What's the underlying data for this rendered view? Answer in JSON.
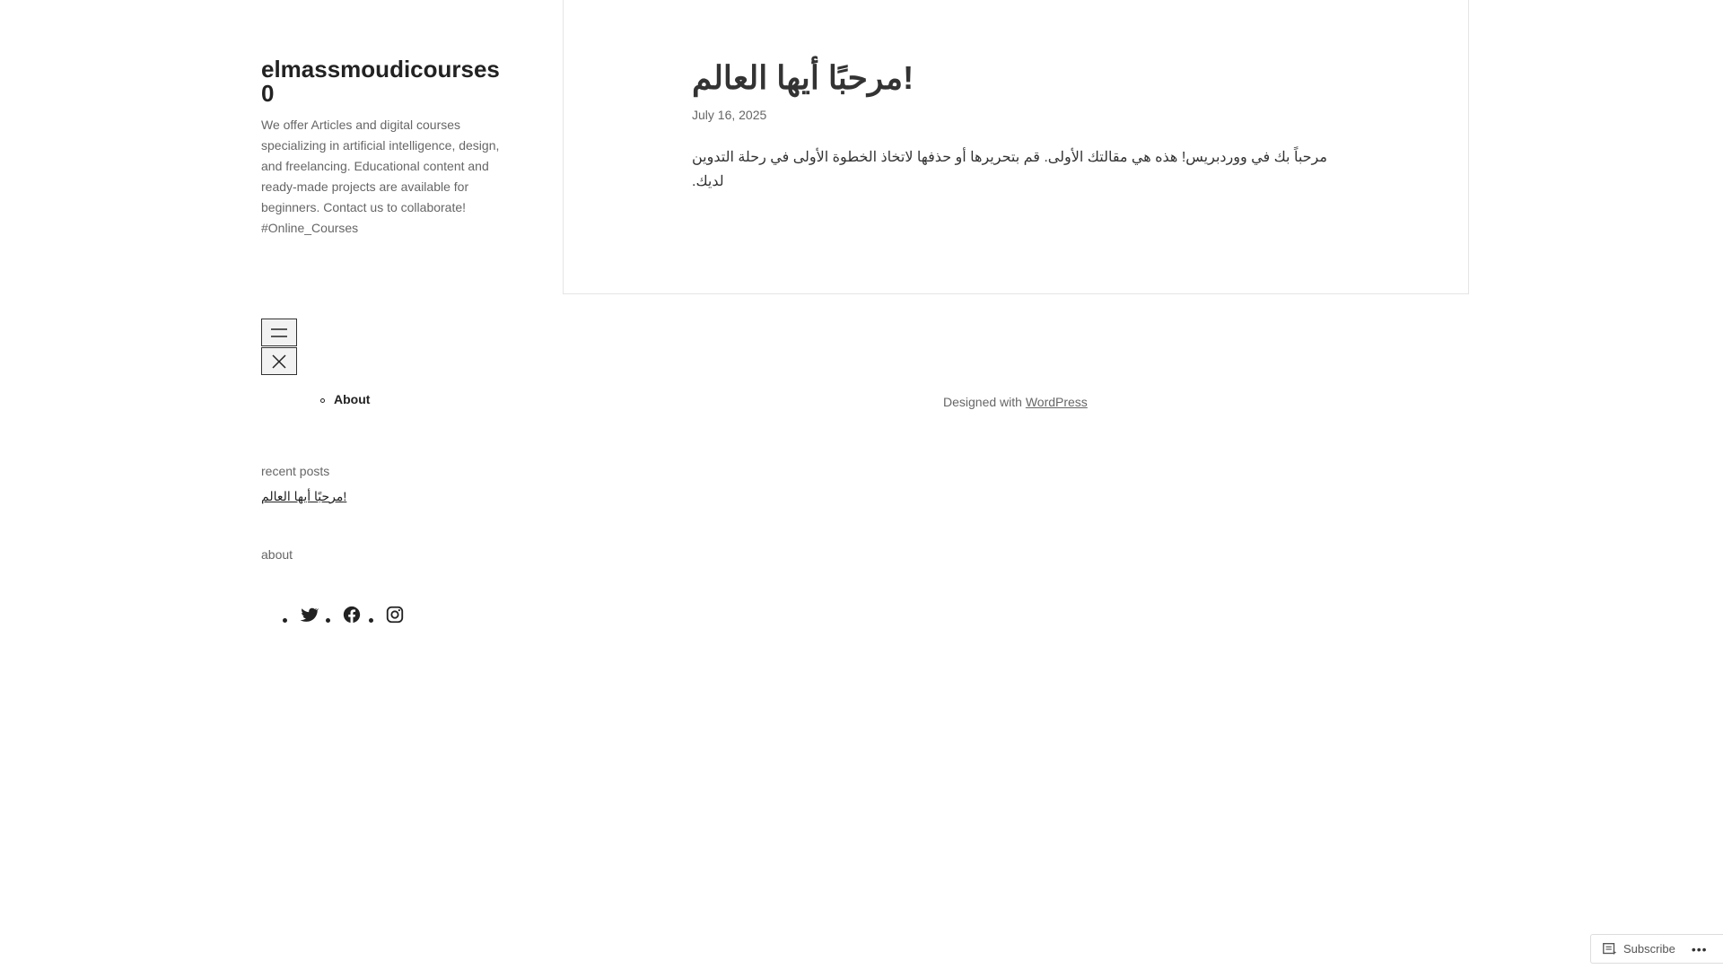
{
  "site": {
    "title": "elmassmoudicourses0",
    "description": "We offer Articles and digital courses specializing in artificial intelligence, design, and freelancing. Educational content and ready-made projects are available for beginners. Contact us to collaborate! #Online_Courses"
  },
  "menu": {
    "toggle_icon": "hamburger-icon",
    "close_icon": "close-icon",
    "items": [
      {
        "label": "About"
      }
    ]
  },
  "widgets": {
    "recent_posts_title": "recent posts",
    "recent_posts": [
      {
        "label": "مرحبًا أيها العالم!"
      }
    ],
    "about_title": "about",
    "social_icons": [
      "twitter-icon",
      "facebook-icon",
      "instagram-icon"
    ]
  },
  "post": {
    "title": "مرحبًا أيها العالم!",
    "date": "July 16, 2025",
    "content": "مرحباً بك في ووردبريس! هذه هي مقالتك الأولى. قم بتحريرها أو حذفها لاتخاذ الخطوة الأولى في رحلة التدوين لديك."
  },
  "footer": {
    "prefix": "Designed with ",
    "link": "WordPress"
  },
  "subscribe": {
    "label": "Subscribe",
    "more": "•••"
  }
}
